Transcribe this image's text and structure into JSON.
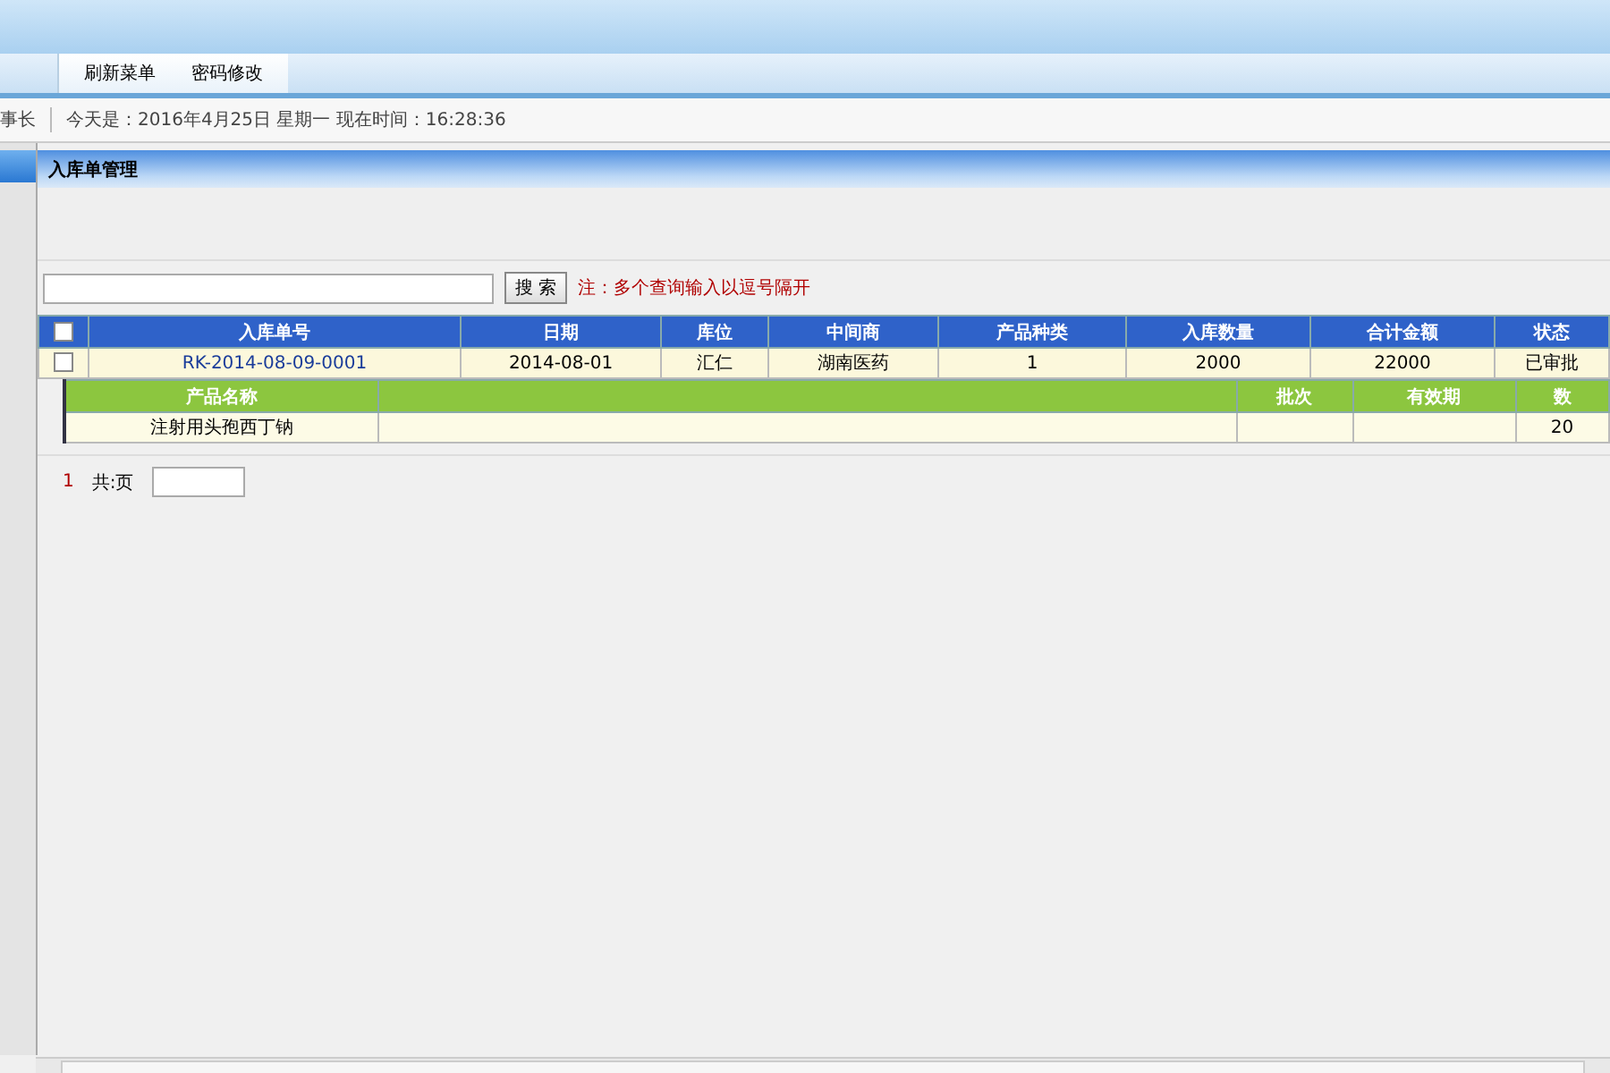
{
  "menu": [
    {
      "label": "刷新菜单"
    },
    {
      "label": "密码修改"
    }
  ],
  "status_bar": {
    "user": "事长",
    "info": "今天是：2016年4月25日 星期一 现在时间：16:28:36"
  },
  "panel": {
    "title": "入库单管理"
  },
  "search": {
    "button": "搜 索",
    "note": "注：多个查询输入以逗号隔开"
  },
  "table": {
    "all_checked": false,
    "columns": [
      "入库单号",
      "日期",
      "库位",
      "中间商",
      "产品种类",
      "入库数量",
      "合计金额",
      "状态"
    ],
    "rows": [
      {
        "checked": false,
        "cells": [
          "RK-2014-08-09-0001",
          "2014-08-01",
          "汇仁",
          "湖南医药",
          "1",
          "2000",
          "22000",
          "已审批"
        ]
      }
    ]
  },
  "subtable": {
    "columns": [
      "产品名称",
      "",
      "批次",
      "有效期",
      "数"
    ],
    "rows": [
      {
        "cells": [
          "注射用头孢西丁钠",
          "",
          "",
          "",
          "20"
        ]
      }
    ]
  },
  "pager": {
    "page": "1",
    "total": "共:页"
  }
}
